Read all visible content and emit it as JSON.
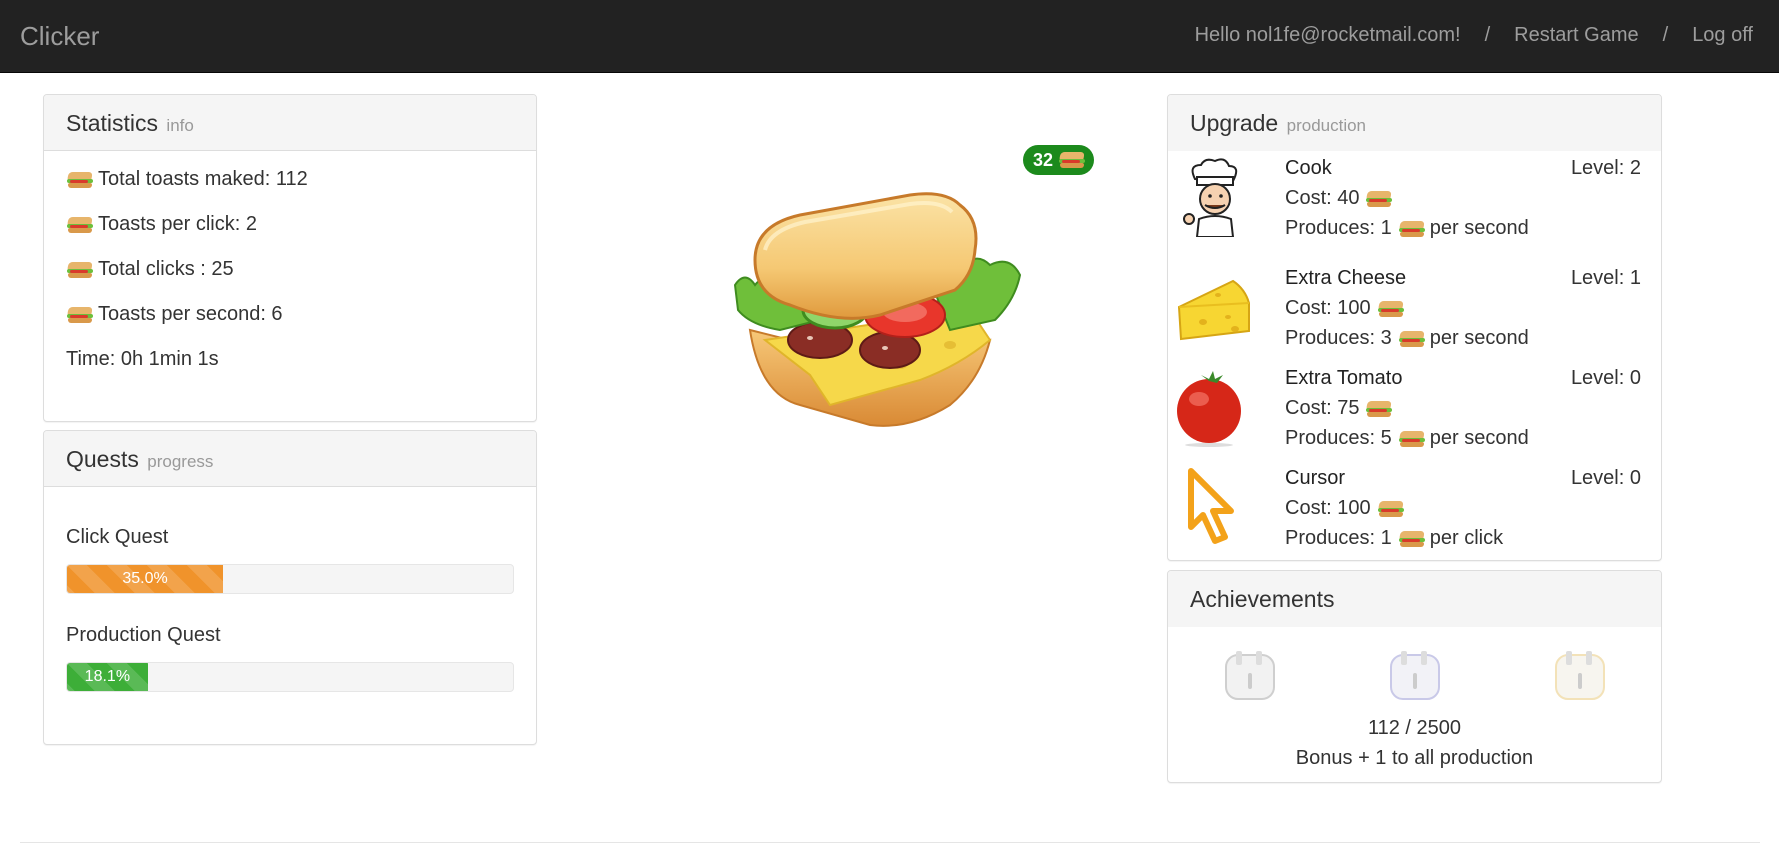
{
  "navbar": {
    "brand": "Clicker",
    "greeting": "Hello nol1fe@rocketmail.com!",
    "separator": "/",
    "restart": "Restart Game",
    "logoff": "Log off"
  },
  "statistics": {
    "title": "Statistics",
    "subtitle": "info",
    "total_toasts": "Total toasts maked: 112",
    "per_click": "Toasts per click: 2",
    "total_clicks": "Total clicks : 25",
    "per_second": "Toasts per second: 6",
    "time": "Time: 0h 1min 1s"
  },
  "quests": {
    "title": "Quests",
    "subtitle": "progress",
    "items": [
      {
        "label": "Click Quest",
        "percent_text": "35.0%",
        "progress": 0.35,
        "color": "#f0932b"
      },
      {
        "label": "Production Quest",
        "percent_text": "18.1%",
        "progress": 0.181,
        "color": "#3dae38"
      }
    ]
  },
  "clicker": {
    "counter": "32",
    "icon": "sandwich-icon"
  },
  "upgrades": {
    "title": "Upgrade",
    "subtitle": "production",
    "items": [
      {
        "name": "Cook",
        "level": "Level: 2",
        "cost": "Cost: 40",
        "prod_prefix": "Produces: 1",
        "prod_suffix": "per second",
        "icon": "chef-icon"
      },
      {
        "name": "Extra Cheese",
        "level": "Level: 1",
        "cost": "Cost: 100",
        "prod_prefix": "Produces: 3",
        "prod_suffix": "per second",
        "icon": "cheese-icon"
      },
      {
        "name": "Extra Tomato",
        "level": "Level: 0",
        "cost": "Cost: 75",
        "prod_prefix": "Produces: 5",
        "prod_suffix": "per second",
        "icon": "tomato-icon"
      },
      {
        "name": "Cursor",
        "level": "Level: 0",
        "cost": "Cost: 100",
        "prod_prefix": "Produces: 1",
        "prod_suffix": "per click",
        "icon": "cursor-icon"
      }
    ]
  },
  "achievements": {
    "title": "Achievements",
    "progress": "112 / 2500",
    "bonus": "Bonus + 1 to all production",
    "toasters": [
      "toaster-icon",
      "toaster-icon",
      "toaster-icon"
    ],
    "toaster_glows": [
      "#d0d0d0",
      "#c9c9e8",
      "#f3e2b8"
    ]
  },
  "colors": {
    "navbar_bg": "#222222",
    "counter_bg": "#1c8a1c"
  }
}
